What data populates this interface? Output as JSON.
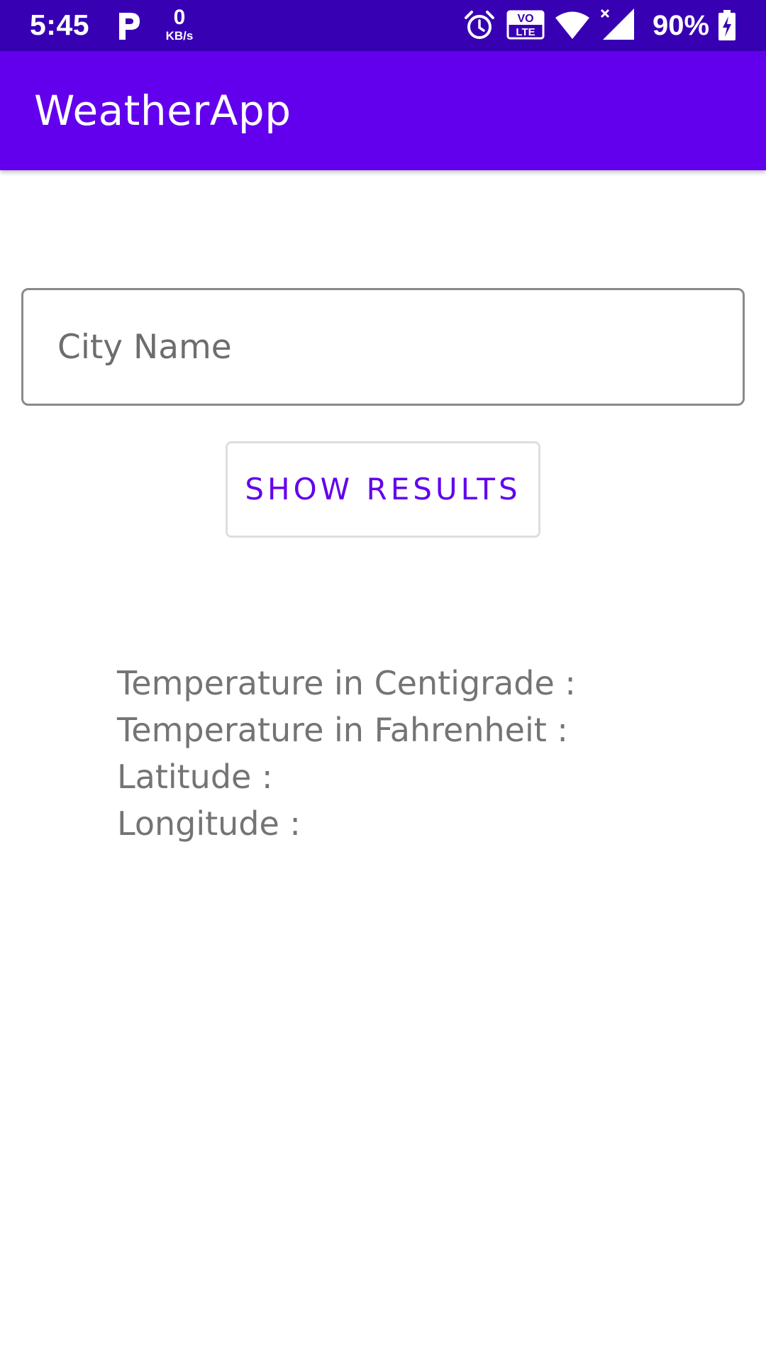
{
  "status_bar": {
    "time": "5:45",
    "network_speed_value": "0",
    "network_speed_unit": "KB/s",
    "volte_top": "VO",
    "volte_bottom": "LTE",
    "battery": "90%",
    "icons": [
      "parking-icon",
      "alarm-icon",
      "volte-icon",
      "wifi-icon",
      "signal-icon",
      "battery-charging-icon"
    ]
  },
  "app_bar": {
    "title": "WeatherApp",
    "color": "#6200EE",
    "status_color": "#3700B3"
  },
  "form": {
    "city_placeholder": "City Name",
    "city_value": "",
    "submit_label": "SHOW RESULTS"
  },
  "results": {
    "temp_c_label": "Temperature in Centigrade :",
    "temp_f_label": "Temperature in Fahrenheit :",
    "latitude_label": "Latitude :",
    "longitude_label": "Longitude :"
  }
}
